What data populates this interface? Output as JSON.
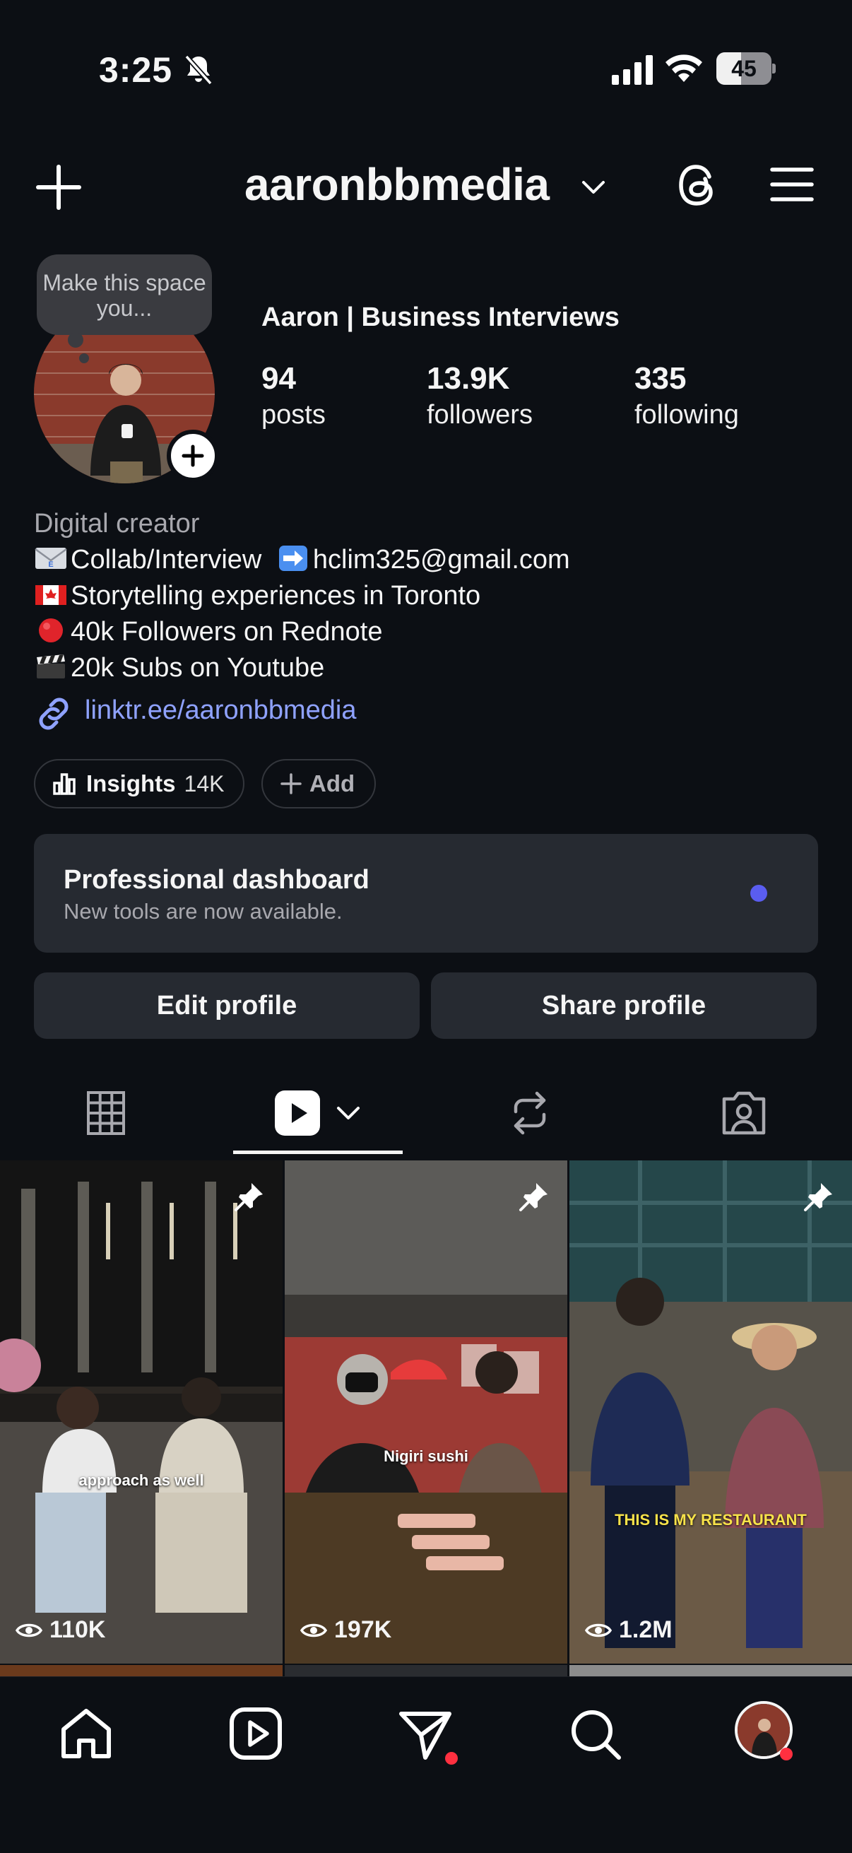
{
  "status_bar": {
    "time": "3:25",
    "battery_percent": "45",
    "battery_level": 0.45
  },
  "header": {
    "username": "aaronbbmedia"
  },
  "profile": {
    "note": "Make this space you...",
    "display_name": "Aaron | Business Interviews",
    "stats": [
      {
        "value": "94",
        "label": "posts"
      },
      {
        "value": "13.9K",
        "label": "followers"
      },
      {
        "value": "335",
        "label": "following"
      }
    ],
    "category": "Digital creator",
    "bio_lines": [
      {
        "emoji": "envelope-e-mail",
        "text": "Collab/Interview"
      },
      {
        "emoji": "flag-canada",
        "text": "Storytelling experiences in Toronto"
      },
      {
        "emoji": "red-circle",
        "text": "40k Followers on Rednote"
      },
      {
        "emoji": "clapper-board",
        "text": "20k Subs on Youtube"
      }
    ],
    "email": "hclim325@gmail.com",
    "link": "linktr.ee/aaronbbmedia"
  },
  "pills": {
    "insights_label": "Insights",
    "insights_value": "14K",
    "add_label": "Add"
  },
  "dashboard": {
    "title": "Professional dashboard",
    "subtitle": "New tools are now available."
  },
  "buttons": {
    "edit": "Edit profile",
    "share": "Share profile"
  },
  "tabs": [
    {
      "icon": "grid-icon"
    },
    {
      "icon": "reels-icon",
      "active": true
    },
    {
      "icon": "repost-icon"
    },
    {
      "icon": "tagged-icon"
    }
  ],
  "posts": [
    {
      "caption": "approach as well",
      "views": "110K",
      "pinned": true
    },
    {
      "caption": "Nigiri sushi",
      "views": "197K",
      "pinned": true
    },
    {
      "caption": "THIS IS MY RESTAURANT",
      "views": "1.2M",
      "pinned": true
    }
  ],
  "bottom_nav": [
    {
      "icon": "home-icon"
    },
    {
      "icon": "reels-icon"
    },
    {
      "icon": "messages-icon",
      "badge": true
    },
    {
      "icon": "search-icon"
    },
    {
      "icon": "profile-avatar",
      "badge": true
    }
  ],
  "colors": {
    "background": "#0c0f14",
    "surface": "#262a31",
    "link": "#8fa2ff",
    "badge": "#ff3040",
    "accent_dot": "#5a5df0"
  }
}
